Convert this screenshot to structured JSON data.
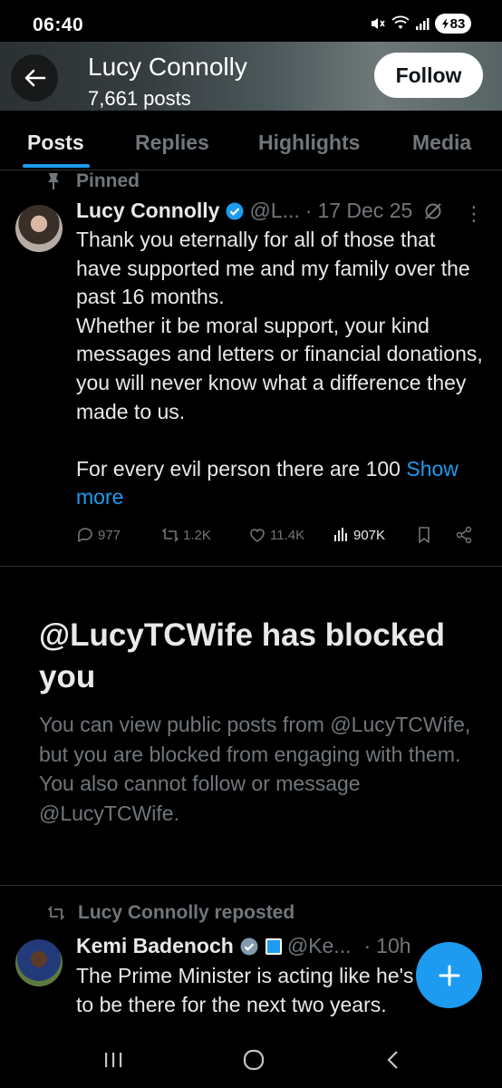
{
  "status_bar": {
    "time": "06:40",
    "battery": "83"
  },
  "header": {
    "name": "Lucy Connolly",
    "post_count": "7,661 posts",
    "follow_label": "Follow"
  },
  "tabs": [
    {
      "label": "Posts",
      "active": true
    },
    {
      "label": "Replies",
      "active": false
    },
    {
      "label": "Highlights",
      "active": false
    },
    {
      "label": "Media",
      "active": false
    }
  ],
  "pinned_post": {
    "pinned_label": "Pinned",
    "author": "Lucy Connolly",
    "handle": "@L...",
    "separator": "·",
    "date": "17 Dec 25",
    "body": "Thank you eternally for all of those that have supported me and my family over the past 16 months.\nWhether it be moral support, your kind messages and letters or financial donations, you will never know what a difference they made to us.\n\nFor every evil person there are 100 ",
    "show_more": "Show more",
    "stats": {
      "replies": "977",
      "reposts": "1.2K",
      "likes": "11.4K",
      "views": "907K"
    }
  },
  "blocked_notice": {
    "title": "@LucyTCWife has blocked you",
    "text": "You can view public posts from @LucyTCWife, but you are blocked from engaging with them. You also cannot follow or message @LucyTCWife."
  },
  "repost": {
    "repost_label": "Lucy Connolly reposted",
    "author": "Kemi Badenoch",
    "handle": "@Ke...",
    "separator": "·",
    "time": "10h",
    "body": "The Prime Minister is acting like he's going to be there for the next two years."
  },
  "colors": {
    "accent": "#1d9bf0",
    "muted": "#71767b",
    "text": "#e7e9ea",
    "background": "#000000"
  }
}
